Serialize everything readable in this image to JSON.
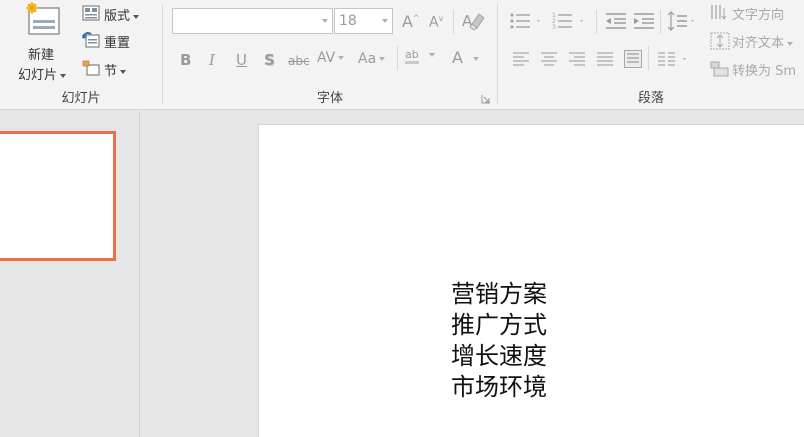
{
  "slides_group": {
    "label": "幻灯片",
    "new_slide_line1": "新建",
    "new_slide_line2": "幻灯片",
    "layout_label": "版式",
    "reset_label": "重置",
    "section_label": "节"
  },
  "font_group": {
    "label": "字体",
    "font_name_value": "",
    "font_size_value": "18",
    "bold_glyph": "B",
    "italic_glyph": "I",
    "underline_glyph": "U",
    "shadow_glyph": "S",
    "strike_glyph": "abc",
    "spacing_glyph": "AV",
    "case_glyph": "Aa",
    "font_color_glyph": "A",
    "grow_glyph": "A",
    "shrink_glyph": "A",
    "highlight_glyph": "ab"
  },
  "paragraph_group": {
    "label": "段落",
    "text_direction_label": "文字方向",
    "align_text_label": "对齐文本",
    "convert_smartart_label": "转换为 Sm"
  },
  "slide": {
    "lines": [
      "营销方案",
      "推广方式",
      "增长速度",
      "市场环境"
    ]
  },
  "colors": {
    "accent_selection": "#e8704f",
    "ribbon_bg": "#f3f3f3",
    "workspace_bg": "#e6e6e6"
  }
}
